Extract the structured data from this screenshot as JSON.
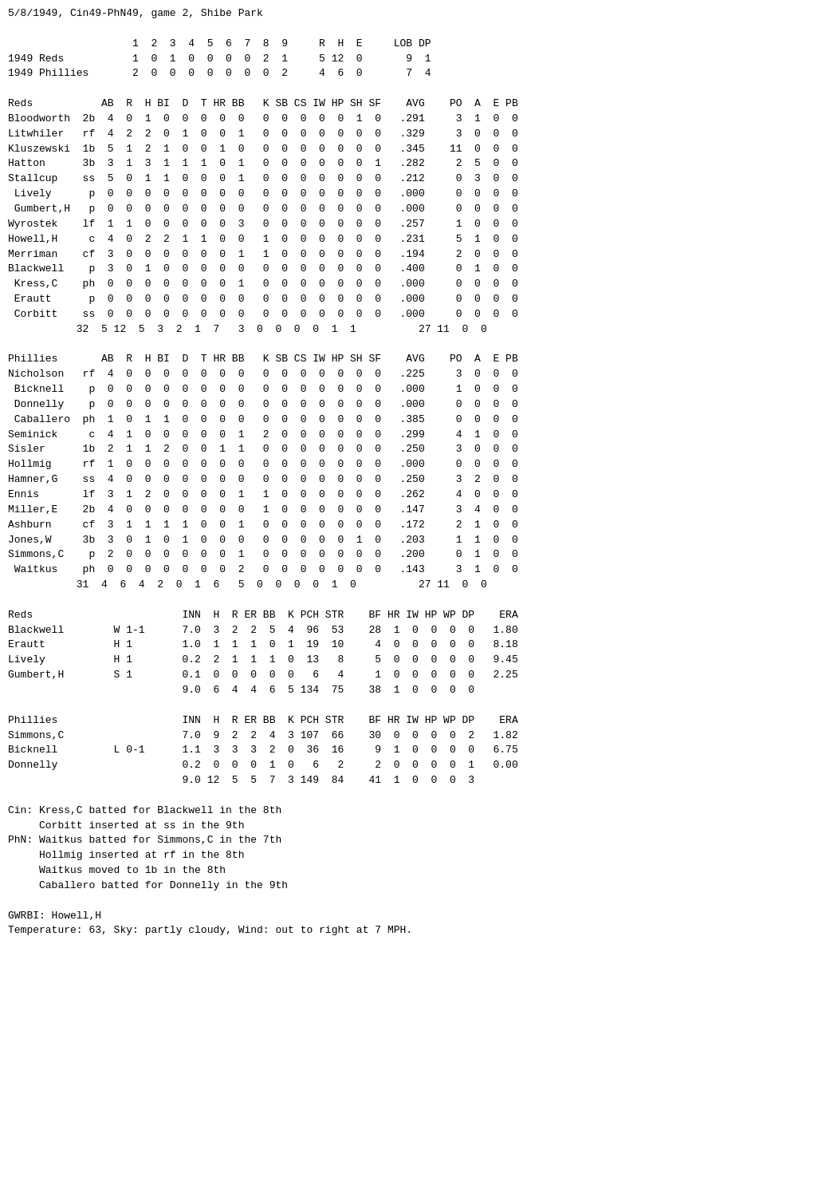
{
  "title": "5/8/1949, Cin49-PhN49, game 2, Shibe Park",
  "content": "5/8/1949, Cin49-PhN49, game 2, Shibe Park\n\n                    1  2  3  4  5  6  7  8  9     R  H  E     LOB DP\n1949 Reds           1  0  1  0  0  0  0  2  1     5 12  0       9  1\n1949 Phillies       2  0  0  0  0  0  0  0  2     4  6  0       7  4\n\nReds           AB  R  H BI  D  T HR BB   K SB CS IW HP SH SF    AVG    PO  A  E PB\nBloodworth  2b  4  0  1  0  0  0  0  0   0  0  0  0  0  1  0   .291     3  1  0  0\nLitwhiler   rf  4  2  2  0  1  0  0  1   0  0  0  0  0  0  0   .329     3  0  0  0\nKluszewski  1b  5  1  2  1  0  0  1  0   0  0  0  0  0  0  0   .345    11  0  0  0\nHatton      3b  3  1  3  1  1  1  0  1   0  0  0  0  0  0  1   .282     2  5  0  0\nStallcup    ss  5  0  1  1  0  0  0  1   0  0  0  0  0  0  0   .212     0  3  0  0\n Lively      p  0  0  0  0  0  0  0  0   0  0  0  0  0  0  0   .000     0  0  0  0\n Gumbert,H   p  0  0  0  0  0  0  0  0   0  0  0  0  0  0  0   .000     0  0  0  0\nWyrostek    lf  1  1  0  0  0  0  0  3   0  0  0  0  0  0  0   .257     1  0  0  0\nHowell,H     c  4  0  2  2  1  1  0  0   1  0  0  0  0  0  0   .231     5  1  0  0\nMerriman    cf  3  0  0  0  0  0  0  1   1  0  0  0  0  0  0   .194     2  0  0  0\nBlackwell    p  3  0  1  0  0  0  0  0   0  0  0  0  0  0  0   .400     0  1  0  0\n Kress,C    ph  0  0  0  0  0  0  0  1   0  0  0  0  0  0  0   .000     0  0  0  0\n Erautt      p  0  0  0  0  0  0  0  0   0  0  0  0  0  0  0   .000     0  0  0  0\n Corbitt    ss  0  0  0  0  0  0  0  0   0  0  0  0  0  0  0   .000     0  0  0  0\n           32  5 12  5  3  2  1  7   3  0  0  0  0  1  1          27 11  0  0\n\nPhillies       AB  R  H BI  D  T HR BB   K SB CS IW HP SH SF    AVG    PO  A  E PB\nNicholson   rf  4  0  0  0  0  0  0  0   0  0  0  0  0  0  0   .225     3  0  0  0\n Bicknell    p  0  0  0  0  0  0  0  0   0  0  0  0  0  0  0   .000     1  0  0  0\n Donnelly    p  0  0  0  0  0  0  0  0   0  0  0  0  0  0  0   .000     0  0  0  0\n Caballero  ph  1  0  1  1  0  0  0  0   0  0  0  0  0  0  0   .385     0  0  0  0\nSeminick     c  4  1  0  0  0  0  0  1   2  0  0  0  0  0  0   .299     4  1  0  0\nSisler      1b  2  1  1  2  0  0  1  1   0  0  0  0  0  0  0   .250     3  0  0  0\nHollmig     rf  1  0  0  0  0  0  0  0   0  0  0  0  0  0  0   .000     0  0  0  0\nHamner,G    ss  4  0  0  0  0  0  0  0   0  0  0  0  0  0  0   .250     3  2  0  0\nEnnis       lf  3  1  2  0  0  0  0  1   1  0  0  0  0  0  0   .262     4  0  0  0\nMiller,E    2b  4  0  0  0  0  0  0  0   1  0  0  0  0  0  0   .147     3  4  0  0\nAshburn     cf  3  1  1  1  1  0  0  1   0  0  0  0  0  0  0   .172     2  1  0  0\nJones,W     3b  3  0  1  0  1  0  0  0   0  0  0  0  0  1  0   .203     1  1  0  0\nSimmons,C    p  2  0  0  0  0  0  0  1   0  0  0  0  0  0  0   .200     0  1  0  0\n Waitkus    ph  0  0  0  0  0  0  0  2   0  0  0  0  0  0  0   .143     3  1  0  0\n           31  4  6  4  2  0  1  6   5  0  0  0  0  1  0          27 11  0  0\n\nReds                        INN  H  R ER BB  K PCH STR    BF HR IW HP WP DP    ERA\nBlackwell        W 1-1      7.0  3  2  2  5  4  96  53    28  1  0  0  0  0   1.80\nErautt           H 1        1.0  1  1  1  0  1  19  10     4  0  0  0  0  0   8.18\nLively           H 1        0.2  2  1  1  1  0  13   8     5  0  0  0  0  0   9.45\nGumbert,H        S 1        0.1  0  0  0  0  0   6   4     1  0  0  0  0  0   2.25\n                            9.0  6  4  4  6  5 134  75    38  1  0  0  0  0\n\nPhillies                    INN  H  R ER BB  K PCH STR    BF HR IW HP WP DP    ERA\nSimmons,C                   7.0  9  2  2  4  3 107  66    30  0  0  0  0  2   1.82\nBicknell         L 0-1      1.1  3  3  3  2  0  36  16     9  1  0  0  0  0   6.75\nDonnelly                    0.2  0  0  0  1  0   6   2     2  0  0  0  0  1   0.00\n                            9.0 12  5  5  7  3 149  84    41  1  0  0  0  3\n\nCin: Kress,C batted for Blackwell in the 8th\n     Corbitt inserted at ss in the 9th\nPhN: Waitkus batted for Simmons,C in the 7th\n     Hollmig inserted at rf in the 8th\n     Waitkus moved to 1b in the 8th\n     Caballero batted for Donnelly in the 9th\n\nGWRBI: Howell,H\nTemperature: 63, Sky: partly cloudy, Wind: out to right at 7 MPH."
}
